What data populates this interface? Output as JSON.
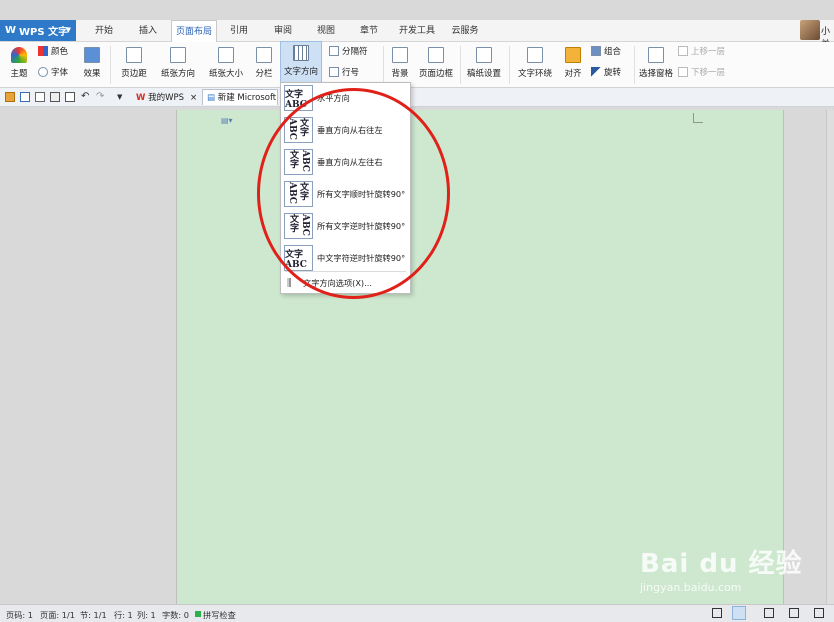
{
  "app": {
    "name": "WPS 文字"
  },
  "tabs": [
    "开始",
    "插入",
    "页面布局",
    "引用",
    "审阅",
    "视图",
    "章节",
    "开发工具",
    "云服务"
  ],
  "active_tab": "页面布局",
  "user": {
    "name": "小羊"
  },
  "ribbon": {
    "theme": "主题",
    "colors": "颜色",
    "font": "字体",
    "effects": "效果",
    "margins": "页边距",
    "orientation": "纸张方向",
    "size": "纸张大小",
    "columns": "分栏",
    "text_direction": "文字方向",
    "separator": "分隔符",
    "line_numbers": "行号",
    "background": "背景",
    "page_border": "页面边框",
    "paper_setup": "稿纸设置",
    "wrap": "文字环绕",
    "align": "对齐",
    "group": "组合",
    "rotate": "旋转",
    "selection_pane": "选择窗格",
    "bring_forward": "上移一层",
    "send_backward": "下移一层"
  },
  "doc_tabs": [
    {
      "label": "我的WPS"
    },
    {
      "label": "新建 Microsoft"
    }
  ],
  "menu": {
    "items": [
      {
        "label": "水平方向",
        "glyph": "文字ABC"
      },
      {
        "label": "垂直方向从右往左",
        "glyph": "文字ABC"
      },
      {
        "label": "垂直方向从左往右",
        "glyph": "文字ABC"
      },
      {
        "label": "所有文字顺时针旋转90°",
        "glyph": "文字ABC"
      },
      {
        "label": "所有文字逆时针旋转90°",
        "glyph": "文字ABC"
      },
      {
        "label": "中文字符逆时针旋转90°",
        "glyph": "文字ABC"
      }
    ],
    "options_label": "文字方向选项(X)..."
  },
  "status": {
    "page_num": "页码: 1",
    "pages": "页面: 1/1",
    "section": "节: 1/1",
    "row": "行: 1",
    "col": "列: 1",
    "chars": "字数: 0",
    "spellcheck": "拼写检查"
  },
  "watermark": {
    "brand": "Bai du 经验",
    "url": "jingyan.baidu.com"
  },
  "colors": {
    "accent": "#2f79c9",
    "page_bg": "#cde8cf",
    "highlight": "#e0211a"
  }
}
